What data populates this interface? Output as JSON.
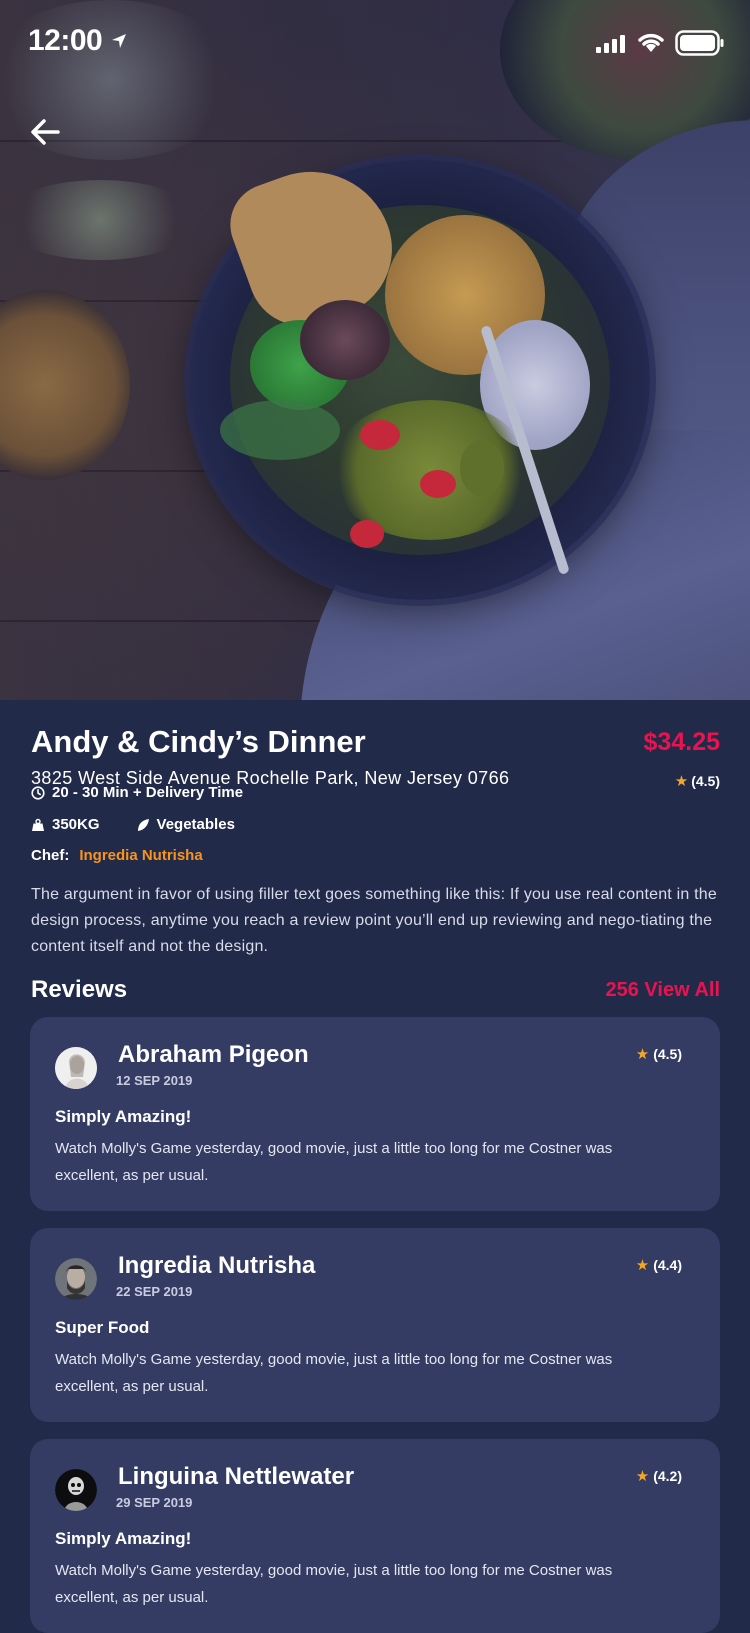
{
  "status_bar": {
    "time": "12:00"
  },
  "icons": {
    "back": "arrow-left-icon",
    "location": "location-arrow-icon",
    "signal": "cellular-signal-icon",
    "wifi": "wifi-icon",
    "battery": "battery-icon",
    "clock": "clock-icon",
    "weight": "weight-icon",
    "leaf": "leaf-icon",
    "star": "star-icon"
  },
  "colors": {
    "accent": "#e8134f",
    "chef": "#f7941d",
    "star": "#f5a623",
    "background": "#222a4a",
    "card": "#343c63"
  },
  "dish": {
    "title": "Andy & Cindy’s Dinner",
    "price": "$34.25",
    "address": "3825 West Side Avenue Rochelle Park, New Jersey 0766",
    "rating": "(4.5)",
    "delivery_time": "20 - 30 Min + Delivery Time",
    "weight": "350KG",
    "category": "Vegetables",
    "chef_label": "Chef:",
    "chef_name": "Ingredia Nutrisha",
    "description": "The argument in favor of using filler text goes something like this: If you use real content in the design process, anytime you reach a review point you’ll end up reviewing and nego-tiating the content itself and not the design."
  },
  "reviews": {
    "heading": "Reviews",
    "view_all": "256 View All",
    "items": [
      {
        "name": "Abraham Pigeon",
        "date": "12 SEP 2019",
        "rating": "(4.5)",
        "title": "Simply Amazing!",
        "body": "Watch Molly's Game yesterday, good movie, just a little too long for me Costner was excellent, as per usual."
      },
      {
        "name": "Ingredia Nutrisha",
        "date": "22 SEP 2019",
        "rating": "(4.4)",
        "title": "Super Food",
        "body": "Watch Molly's Game yesterday, good movie, just a little too long for me Costner was excellent, as per usual."
      },
      {
        "name": "Linguina Nettlewater",
        "date": "29 SEP 2019",
        "rating": "(4.2)",
        "title": "Simply Amazing!",
        "body": "Watch Molly's Game yesterday, good movie, just a little too long for me Costner was excellent, as per usual."
      }
    ]
  }
}
